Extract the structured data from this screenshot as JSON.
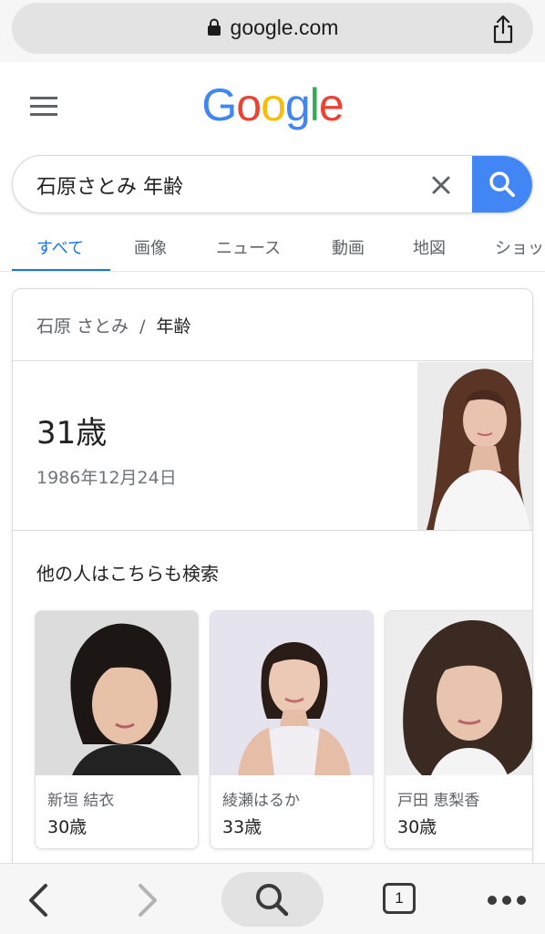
{
  "browser": {
    "url": "google.com",
    "tabs_count": "1"
  },
  "google": {
    "logo_letters": [
      "G",
      "o",
      "o",
      "g",
      "l",
      "e"
    ],
    "logo_colors": [
      "#4285f4",
      "#ea4335",
      "#fbbc05",
      "#4285f4",
      "#34a853",
      "#ea4335"
    ]
  },
  "search": {
    "query": "石原さとみ 年齢"
  },
  "tabs": [
    {
      "label": "すべて",
      "active": true
    },
    {
      "label": "画像"
    },
    {
      "label": "ニュース"
    },
    {
      "label": "動画"
    },
    {
      "label": "地図"
    },
    {
      "label": "ショッ"
    }
  ],
  "knowledge": {
    "breadcrumb_name": "石原 さとみ",
    "breadcrumb_sep": "/",
    "breadcrumb_topic": "年齢",
    "age": "31歳",
    "birth_date": "1986年12月24日"
  },
  "related": {
    "heading": "他の人はこちらも検索",
    "people": [
      {
        "name": "新垣 結衣",
        "age": "30歳"
      },
      {
        "name": "綾瀬はるか",
        "age": "33歳"
      },
      {
        "name": "戸田 恵梨香",
        "age": "30歳"
      }
    ]
  },
  "colors": {
    "accent": "#1a73e8",
    "search_button": "#4285f4"
  }
}
